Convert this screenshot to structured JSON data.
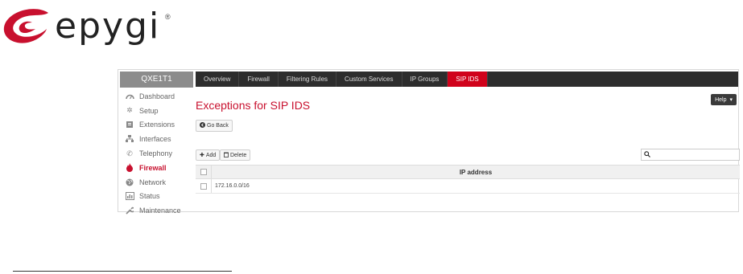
{
  "logo": {
    "text": "epygi",
    "reg": "®",
    "brand_color": "#c8102e"
  },
  "device": {
    "name": "QXE1T1"
  },
  "sidebar": {
    "items": [
      {
        "label": "Dashboard",
        "icon": "dashboard-icon"
      },
      {
        "label": "Setup",
        "icon": "gear-icon"
      },
      {
        "label": "Extensions",
        "icon": "extensions-icon"
      },
      {
        "label": "Interfaces",
        "icon": "interfaces-icon"
      },
      {
        "label": "Telephony",
        "icon": "phone-icon"
      },
      {
        "label": "Firewall",
        "icon": "flame-icon",
        "active": true
      },
      {
        "label": "Network",
        "icon": "globe-icon"
      },
      {
        "label": "Status",
        "icon": "chart-icon"
      },
      {
        "label": "Maintenance",
        "icon": "wrench-icon"
      }
    ]
  },
  "tabs": [
    {
      "label": "Overview"
    },
    {
      "label": "Firewall"
    },
    {
      "label": "Filtering Rules"
    },
    {
      "label": "Custom Services"
    },
    {
      "label": "IP Groups"
    },
    {
      "label": "SIP IDS",
      "active": true
    }
  ],
  "page": {
    "title": "Exceptions for SIP IDS"
  },
  "help": {
    "label": "Help"
  },
  "buttons": {
    "go_back": "Go Back",
    "add": "Add",
    "delete": "Delete"
  },
  "search": {
    "value": "",
    "placeholder": ""
  },
  "table": {
    "columns": [
      "IP address"
    ],
    "rows": [
      {
        "ip": "172.16.0.0/16"
      }
    ]
  },
  "colors": {
    "accent": "#d0021b",
    "topbar": "#2d2d2d",
    "device_bar": "#8c8c8c"
  }
}
